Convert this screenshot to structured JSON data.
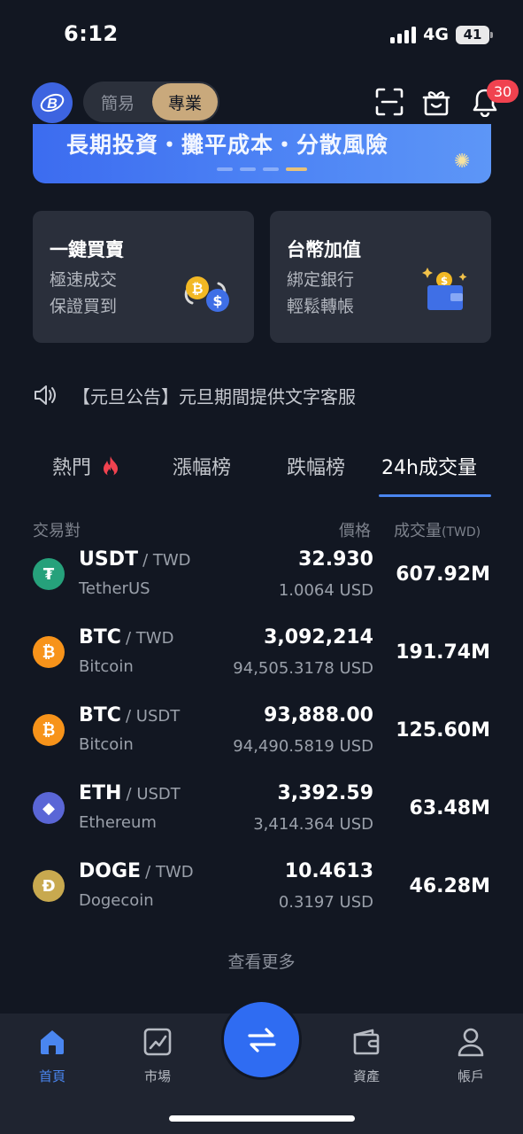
{
  "status_bar": {
    "time": "6:12",
    "network": "4G",
    "battery": "41"
  },
  "header": {
    "mode_simple": "簡易",
    "mode_pro": "專業",
    "notification_count": "30"
  },
  "banner": {
    "text": "長期投資・攤平成本・分散風險"
  },
  "cards": [
    {
      "title": "一鍵買賣",
      "line1": "極速成交",
      "line2": "保證買到"
    },
    {
      "title": "台幣加值",
      "line1": "綁定銀行",
      "line2": "輕鬆轉帳"
    }
  ],
  "announcement": {
    "text": "【元旦公告】元旦期間提供文字客服"
  },
  "tabs": [
    {
      "label": "熱門"
    },
    {
      "label": "漲幅榜"
    },
    {
      "label": "跌幅榜"
    },
    {
      "label": "24h成交量"
    }
  ],
  "table": {
    "col_pair": "交易對",
    "col_price": "價格",
    "col_volume": "成交量",
    "col_volume_unit": "(TWD)",
    "rows": [
      {
        "base": "USDT",
        "quote": "/ TWD",
        "name": "TetherUS",
        "price": "32.930",
        "usd": "1.0064 USD",
        "volume": "607.92M",
        "icon": "tether-icon",
        "color": "#26a17b",
        "glyph": "₮"
      },
      {
        "base": "BTC",
        "quote": "/ TWD",
        "name": "Bitcoin",
        "price": "3,092,214",
        "usd": "94,505.3178 USD",
        "volume": "191.74M",
        "icon": "bitcoin-icon",
        "color": "#f7931a",
        "glyph": "₿"
      },
      {
        "base": "BTC",
        "quote": "/ USDT",
        "name": "Bitcoin",
        "price": "93,888.00",
        "usd": "94,490.5819 USD",
        "volume": "125.60M",
        "icon": "bitcoin-icon",
        "color": "#f7931a",
        "glyph": "₿"
      },
      {
        "base": "ETH",
        "quote": "/ USDT",
        "name": "Ethereum",
        "price": "3,392.59",
        "usd": "3,414.364 USD",
        "volume": "63.48M",
        "icon": "ethereum-icon",
        "color": "#5a66d6",
        "glyph": "◆"
      },
      {
        "base": "DOGE",
        "quote": "/ TWD",
        "name": "Dogecoin",
        "price": "10.4613",
        "usd": "0.3197 USD",
        "volume": "46.28M",
        "icon": "dogecoin-icon",
        "color": "#c8a94f",
        "glyph": "Ð"
      }
    ]
  },
  "view_more": "查看更多",
  "bottom_nav": [
    {
      "label": "首頁",
      "icon": "home-icon"
    },
    {
      "label": "市場",
      "icon": "chart-icon"
    },
    {
      "label": "資產",
      "icon": "wallet-icon"
    },
    {
      "label": "帳戶",
      "icon": "user-icon"
    }
  ],
  "colors": {
    "accent": "#4a86f0",
    "background": "#121722",
    "pro_gold": "#c9a97c"
  }
}
